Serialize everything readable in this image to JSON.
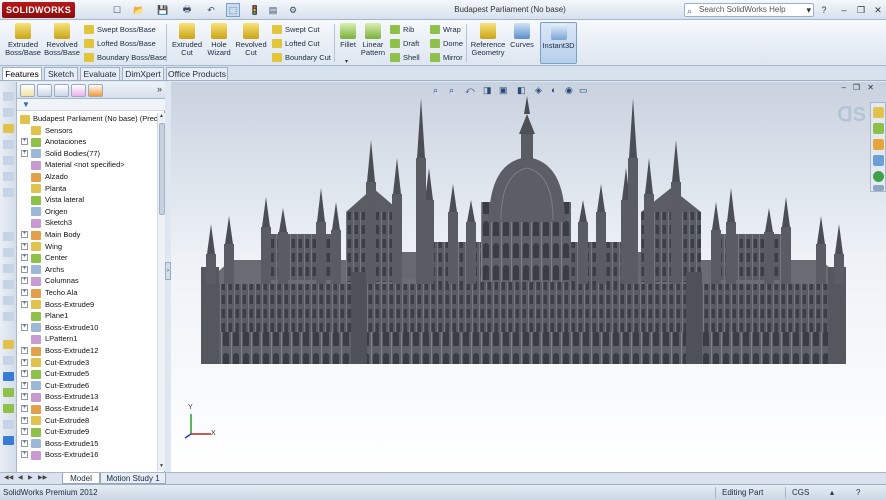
{
  "app": {
    "logo": "SOLIDWORKS",
    "title": "Budapest Parliament (No base)",
    "search_placeholder": "Search SolidWorks Help",
    "minimize": "–",
    "restore": "❐",
    "close": "✕"
  },
  "quick_access": {
    "new": "☐",
    "open": "📂",
    "save": "💾",
    "print": "🖶",
    "undo": "↶",
    "select": "⬚",
    "rebuild": "🚦",
    "file_props": "▤",
    "options": "⚙"
  },
  "ribbon": {
    "features": {
      "extruded_boss": "Extruded Boss/Base",
      "revolved_boss": "Revolved Boss/Base",
      "swept_boss": "Swept Boss/Base",
      "lofted_boss": "Lofted Boss/Base",
      "boundary_boss": "Boundary Boss/Base",
      "extruded_cut": "Extruded Cut",
      "hole_wizard": "Hole Wizard",
      "revolved_cut": "Revolved Cut",
      "swept_cut": "Swept Cut",
      "lofted_cut": "Lofted Cut",
      "boundary_cut": "Boundary Cut",
      "fillet": "Fillet",
      "linear_pattern": "Linear Pattern",
      "rib": "Rib",
      "draft": "Draft",
      "shell": "Shell",
      "wrap": "Wrap",
      "dome": "Dome",
      "mirror": "Mirror",
      "reference_geometry": "Reference Geometry",
      "curves": "Curves",
      "instant3d": "Instant3D"
    }
  },
  "cm_tabs": [
    "Features",
    "Sketch",
    "Evaluate",
    "DimXpert",
    "Office Products"
  ],
  "feature_tree": {
    "root": "Budapest Parliament (No base)  (Prede",
    "items": [
      {
        "label": "Sensors",
        "expand": false
      },
      {
        "label": "Anotaciones",
        "expand": true
      },
      {
        "label": "Solid Bodies(77)",
        "expand": true
      },
      {
        "label": "Material <not specified>",
        "expand": false
      },
      {
        "label": "Alzado",
        "expand": false
      },
      {
        "label": "Planta",
        "expand": false
      },
      {
        "label": "Vista lateral",
        "expand": false
      },
      {
        "label": "Origen",
        "expand": false
      },
      {
        "label": "Sketch3",
        "expand": false
      },
      {
        "label": "Main Body",
        "expand": true
      },
      {
        "label": "Wing",
        "expand": true
      },
      {
        "label": "Center",
        "expand": true
      },
      {
        "label": "Archs",
        "expand": true
      },
      {
        "label": "Columnas",
        "expand": true
      },
      {
        "label": "Techo Ala",
        "expand": true
      },
      {
        "label": "Boss-Extrude9",
        "expand": true
      },
      {
        "label": "Plane1",
        "expand": false
      },
      {
        "label": "Boss-Extrude10",
        "expand": true
      },
      {
        "label": "LPattern1",
        "expand": false
      },
      {
        "label": "Boss-Extrude12",
        "expand": true
      },
      {
        "label": "Cut-Extrude3",
        "expand": true
      },
      {
        "label": "Cut-Extrude5",
        "expand": true
      },
      {
        "label": "Cut-Extrude6",
        "expand": true
      },
      {
        "label": "Boss-Extrude13",
        "expand": true
      },
      {
        "label": "Boss-Extrude14",
        "expand": true
      },
      {
        "label": "Cut-Extrude8",
        "expand": true
      },
      {
        "label": "Cut-Extrude9",
        "expand": true
      },
      {
        "label": "Boss-Extrude15",
        "expand": true
      },
      {
        "label": "Boss-Extrude16",
        "expand": true
      }
    ]
  },
  "bottom_tabs": [
    "Model",
    "Motion Study 1"
  ],
  "status": {
    "product": "SolidWorks Premium 2012",
    "mode": "Editing Part",
    "units": "CGS",
    "help": "?"
  },
  "triad": {
    "x": "X",
    "y": "Y"
  },
  "colors": {
    "accent": "#2d66b3",
    "model": "#55575f",
    "logo_red": "#b81818"
  }
}
